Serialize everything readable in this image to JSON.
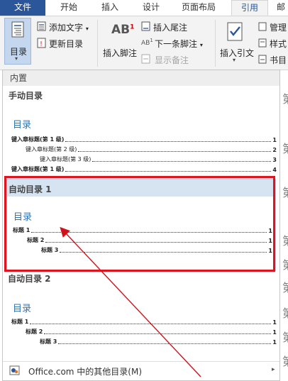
{
  "tabs": {
    "file": "文件",
    "home": "开始",
    "insert": "插入",
    "design": "设计",
    "layout": "页面布局",
    "references": "引用",
    "mailings": "邮"
  },
  "ribbon": {
    "toc_label": "目录",
    "add_text": "添加文字",
    "update_toc": "更新目录",
    "insert_footnote": "插入脚注",
    "insert_endnote": "插入尾注",
    "next_footnote": "下一条脚注",
    "show_notes": "显示备注",
    "insert_citation": "插入引文",
    "manage": "管理",
    "style": "样式",
    "bibliography": "书目"
  },
  "gallery": {
    "header": "内置",
    "manual": {
      "title": "手动目录",
      "heading": "目录",
      "lines": [
        {
          "text": "键入章标题(第 1 级)",
          "page": "1"
        },
        {
          "text": "键入章标题(第 2 级)",
          "page": "2"
        },
        {
          "text": "键入章标题(第 3 级)",
          "page": "3"
        },
        {
          "text": "键入章标题(第 1 级)",
          "page": "4"
        }
      ]
    },
    "auto1": {
      "title": "自动目录 1",
      "heading": "目录",
      "lines": [
        {
          "text": "标题 1",
          "page": "1"
        },
        {
          "text": "标题 2",
          "page": "1"
        },
        {
          "text": "标题 3",
          "page": "1"
        }
      ]
    },
    "auto2": {
      "title": "自动目录 2",
      "heading": "目录",
      "lines": [
        {
          "text": "标题 1",
          "page": "1"
        },
        {
          "text": "标题 2",
          "page": "1"
        },
        {
          "text": "标题 3",
          "page": "1"
        }
      ]
    },
    "more": "Office.com 中的其他目录(M)"
  },
  "doc_chars": [
    "第",
    "第",
    "第",
    "第",
    "第",
    "第",
    "第",
    "第",
    "第"
  ],
  "colors": {
    "accent": "#2b579a",
    "highlight_border": "#e0141e",
    "toc_heading": "#2e74b5"
  }
}
